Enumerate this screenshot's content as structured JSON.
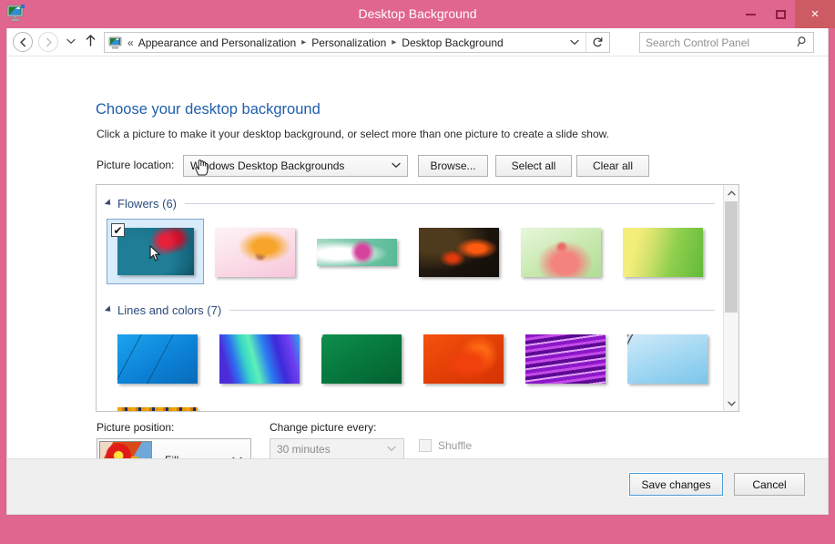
{
  "window": {
    "title": "Desktop Background",
    "app_icon": "display-monitor-icon",
    "frame_color": "#e0658f",
    "close_bg": "#cd5b63",
    "controls": {
      "minimize": "minimize-icon",
      "maximize": "maximize-icon",
      "close": "×"
    }
  },
  "navbar": {
    "back": "◀",
    "forward": "▶",
    "recent_dropdown": "⌄",
    "up": "↑",
    "breadcrumb_icon": "personalization-icon",
    "breadcrumb_prefix": "«",
    "breadcrumbs": [
      "Appearance and Personalization",
      "Personalization",
      "Desktop Background"
    ],
    "breadcrumb_separator": "▸",
    "address_dropdown": "⌄",
    "refresh": "↻",
    "search": {
      "placeholder": "Search Control Panel",
      "value": "",
      "icon": "search-icon"
    }
  },
  "page": {
    "title": "Choose your desktop background",
    "description": "Click a picture to make it your desktop background, or select more than one picture to create a slide show.",
    "title_color": "#1f5faa"
  },
  "picture_location": {
    "label": "Picture location:",
    "selected": "Windows Desktop Backgrounds",
    "dropdown_arrow": "⌄",
    "buttons": {
      "browse": "Browse...",
      "select_all": "Select all",
      "clear_all": "Clear all"
    }
  },
  "gallery": {
    "scrollbar": {
      "up_arrow": "⌃",
      "down_arrow": "⌄",
      "thumb_position_percent": 0,
      "thumb_size_percent": 55
    },
    "sections": [
      {
        "title": "Flowers (6)",
        "count": 6,
        "collapse_icon": "triangle-collapse-icon",
        "thumbnails": [
          {
            "art": "art1",
            "selected": true,
            "checked": true,
            "aspect": "wide",
            "name": "teal-red-flower"
          },
          {
            "art": "art2",
            "selected": false,
            "checked": false,
            "aspect": "wide",
            "name": "yellow-daisy-pink"
          },
          {
            "art": "art3",
            "selected": false,
            "checked": false,
            "aspect": "pano",
            "name": "pink-bloom-green-panorama"
          },
          {
            "art": "art4",
            "selected": false,
            "checked": false,
            "aspect": "wide",
            "name": "red-tulips-dark"
          },
          {
            "art": "art5",
            "selected": false,
            "checked": false,
            "aspect": "wide",
            "name": "pink-orchid-green"
          },
          {
            "art": "art6",
            "selected": false,
            "checked": false,
            "aspect": "wide",
            "name": "green-leaves-yellow"
          }
        ]
      },
      {
        "title": "Lines and colors (7)",
        "count": 7,
        "collapse_icon": "triangle-collapse-icon",
        "thumbnails": [
          {
            "art": "art7",
            "selected": false,
            "checked": false,
            "aspect": "wide",
            "name": "blue-lines-abstract"
          },
          {
            "art": "art8",
            "selected": false,
            "checked": false,
            "aspect": "wide",
            "name": "balloon-panels-blue-teal"
          },
          {
            "art": "art9",
            "selected": false,
            "checked": false,
            "aspect": "wide",
            "name": "green-diagonal-abstract"
          },
          {
            "art": "art10",
            "selected": false,
            "checked": false,
            "aspect": "wide",
            "name": "orange-red-swirl"
          },
          {
            "art": "art11",
            "selected": false,
            "checked": false,
            "aspect": "wide",
            "name": "purple-ribbons"
          },
          {
            "art": "art12",
            "selected": false,
            "checked": false,
            "aspect": "wide",
            "name": "light-blue-curves"
          },
          {
            "art": "art13",
            "selected": false,
            "checked": false,
            "aspect": "wide",
            "name": "orange-glass-building"
          }
        ]
      }
    ]
  },
  "picture_position": {
    "label": "Picture position:",
    "selected": "Fill",
    "dropdown_arrow": "⌄",
    "preview_icon": "flower-photo-preview"
  },
  "change_picture": {
    "label": "Change picture every:",
    "selected": "30 minutes",
    "dropdown_arrow": "⌄",
    "disabled": true
  },
  "shuffle": {
    "label": "Shuffle",
    "checked": false,
    "disabled": true
  },
  "footer": {
    "save_label": "Save changes",
    "cancel_label": "Cancel",
    "default_button_accent": "#4c9ed9"
  }
}
